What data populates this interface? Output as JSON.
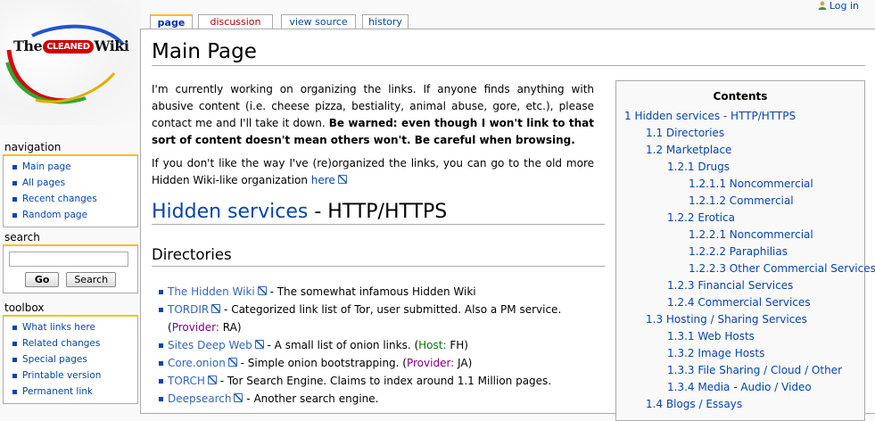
{
  "logo": {
    "text_left": "The",
    "text_mid": "CLEANED",
    "text_right": "Wiki"
  },
  "header": {
    "login_label": "Log in"
  },
  "tabs": [
    {
      "label": "page"
    },
    {
      "label": "discussion"
    },
    {
      "label": "view source"
    },
    {
      "label": "history"
    }
  ],
  "navigation": {
    "title": "navigation",
    "items": [
      "Main page",
      "All pages",
      "Recent changes",
      "Random page"
    ]
  },
  "search": {
    "title": "search",
    "value": "",
    "go_label": "Go",
    "search_label": "Search"
  },
  "toolbox": {
    "title": "toolbox",
    "items": [
      "What links here",
      "Related changes",
      "Special pages",
      "Printable version",
      "Permanent link"
    ]
  },
  "page": {
    "title": "Main Page",
    "intro": "I'm currently working on organizing the links. If anyone finds anything with abusive content (i.e. cheese pizza, bestiality, animal abuse, gore, etc.), please contact me and I'll take it down. ",
    "intro_bold": "Be warned: even though I won't link to that sort of content doesn't mean others won't. Be careful when browsing.",
    "old_org_text": "If you don't like the way I've (re)organized the links, you can go to the old more Hidden Wiki-like organization ",
    "old_org_link": "here",
    "section_title_link": "Hidden services",
    "section_title_rest": " - HTTP/HTTPS",
    "subsection_title": "Directories",
    "directories": [
      {
        "name": "The Hidden Wiki",
        "desc": " - The somewhat infamous Hidden Wiki",
        "tag": "",
        "tag_value": ""
      },
      {
        "name": "TORDIR",
        "desc": " - Categorized link list of Tor, user submitted. Also a PM service. (",
        "tag": "Provider:",
        "tag_value": " RA)"
      },
      {
        "name": "Sites Deep Web",
        "desc": " - A small list of onion links. (",
        "tag": "Host:",
        "tag_value": " FH)"
      },
      {
        "name": "Core.onion",
        "desc": " - Simple onion bootstrapping. (",
        "tag": "Provider:",
        "tag_value": " JA)"
      },
      {
        "name": "TORCH",
        "desc": " - Tor Search Engine. Claims to index around 1.1 Million pages.",
        "tag": "",
        "tag_value": ""
      },
      {
        "name": "Deepsearch",
        "desc": " - Another search engine.",
        "tag": "",
        "tag_value": ""
      }
    ]
  },
  "toc": {
    "title": "Contents",
    "items": [
      {
        "num": "1",
        "label": "Hidden services - HTTP/HTTPS",
        "level": 1
      },
      {
        "num": "1.1",
        "label": "Directories",
        "level": 2
      },
      {
        "num": "1.2",
        "label": "Marketplace",
        "level": 2
      },
      {
        "num": "1.2.1",
        "label": "Drugs",
        "level": 3
      },
      {
        "num": "1.2.1.1",
        "label": "Noncommercial",
        "level": 4
      },
      {
        "num": "1.2.1.2",
        "label": "Commercial",
        "level": 4
      },
      {
        "num": "1.2.2",
        "label": "Erotica",
        "level": 3
      },
      {
        "num": "1.2.2.1",
        "label": "Noncommercial",
        "level": 4
      },
      {
        "num": "1.2.2.2",
        "label": "Paraphilias",
        "level": 4
      },
      {
        "num": "1.2.2.3",
        "label": "Other Commercial Services",
        "level": 4
      },
      {
        "num": "1.2.3",
        "label": "Financial Services",
        "level": 3
      },
      {
        "num": "1.2.4",
        "label": "Commercial Services",
        "level": 3
      },
      {
        "num": "1.3",
        "label": "Hosting / Sharing Services",
        "level": 2
      },
      {
        "num": "1.3.1",
        "label": "Web Hosts",
        "level": 3
      },
      {
        "num": "1.3.2",
        "label": "Image Hosts",
        "level": 3
      },
      {
        "num": "1.3.3",
        "label": "File Sharing / Cloud / Other",
        "level": 3
      },
      {
        "num": "1.3.4",
        "label": "Media - Audio / Video",
        "level": 3
      },
      {
        "num": "1.4",
        "label": "Blogs / Essays",
        "level": 2
      }
    ]
  },
  "colors": {
    "link": "#0645ad",
    "external_link": "#3366bb",
    "portlet_accent": "#fabd23",
    "new_link": "#ba0000",
    "provider_tag": "#800080",
    "host_tag": "#008000"
  }
}
